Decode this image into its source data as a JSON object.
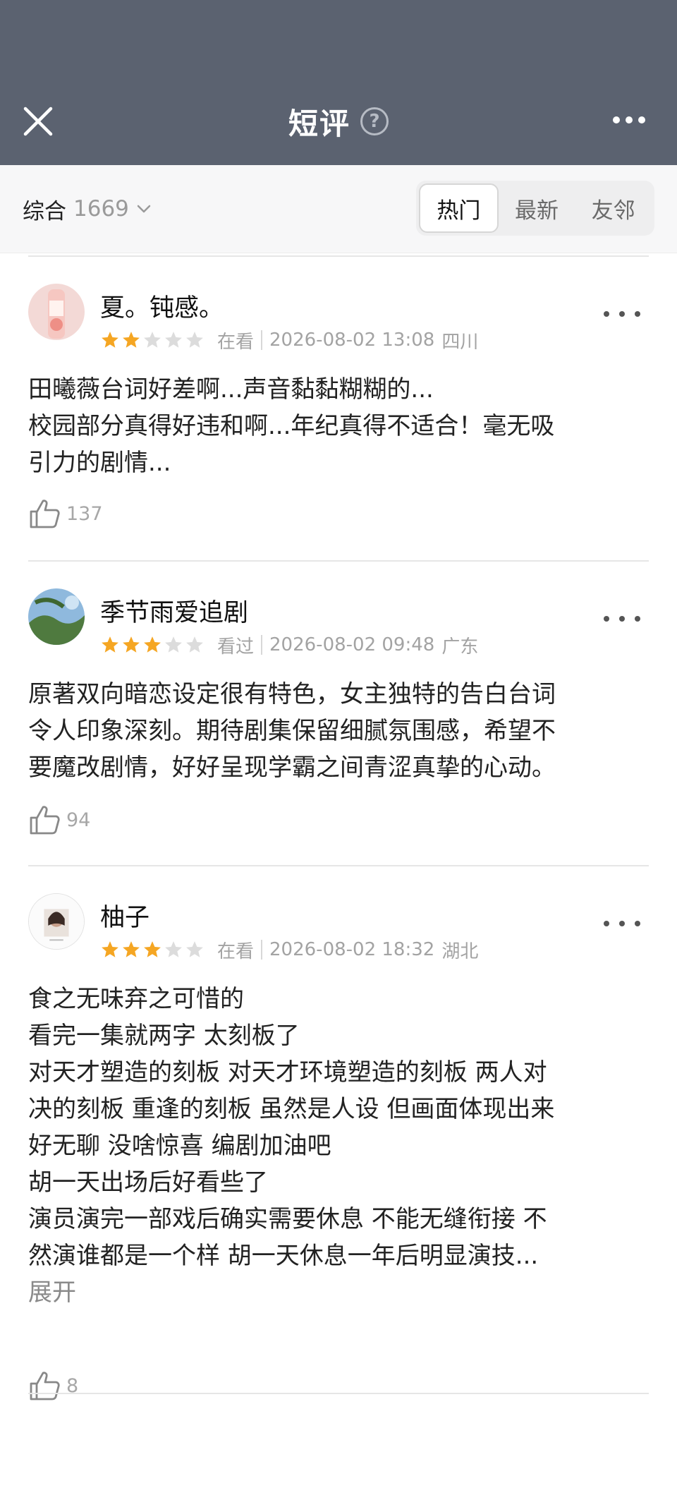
{
  "header": {
    "title": "短评",
    "help_glyph": "?",
    "icons": {
      "close": "close-icon",
      "help": "question-circle-icon",
      "more": "more-horizontal-icon"
    },
    "background": "#5b6270"
  },
  "filter": {
    "label": "综合",
    "count": "1669",
    "tabs": [
      {
        "label": "热门",
        "active": true
      },
      {
        "label": "最新",
        "active": false
      },
      {
        "label": "友邻",
        "active": false
      }
    ]
  },
  "reviews": [
    {
      "username": "夏。钝感。",
      "rating": 2,
      "status": "在看",
      "time": "2026-08-02 13:08",
      "location": "四川",
      "lines": [
        "田曦薇台词好差啊...声音黏黏糊糊的...",
        "校园部分真得好违和啊...年纪真得不适合！毫无吸",
        "引力的剧情..."
      ],
      "likes": "137"
    },
    {
      "username": "季节雨爱追剧",
      "rating": 3,
      "status": "看过",
      "time": "2026-08-02 09:48",
      "location": "广东",
      "lines": [
        "原著双向暗恋设定很有特色，女主独特的告白台词",
        "令人印象深刻。期待剧集保留细腻氛围感，希望不",
        "要魔改剧情，好好呈现学霸之间青涩真挚的心动。"
      ],
      "likes": "94"
    },
    {
      "username": "柚子",
      "rating": 3,
      "status": "在看",
      "time": "2026-08-02 18:32",
      "location": "湖北",
      "lines": [
        "食之无味弃之可惜的",
        "看完一集就两字 太刻板了",
        "对天才塑造的刻板 对天才环境塑造的刻板 两人对",
        "决的刻板 重逢的刻板 虽然是人设 但画面体现出来",
        "好无聊 没啥惊喜 编剧加油吧",
        "胡一天出场后好看些了",
        "演员演完一部戏后确实需要休息 不能无缝衔接 不",
        "然演谁都是一个样 胡一天休息一年后明显演技..."
      ],
      "expand_label": "展开",
      "likes": "8"
    }
  ],
  "colors": {
    "star_on": "#f5a623",
    "star_off": "#dcdcdc",
    "meta_text": "#a3a3a3"
  }
}
